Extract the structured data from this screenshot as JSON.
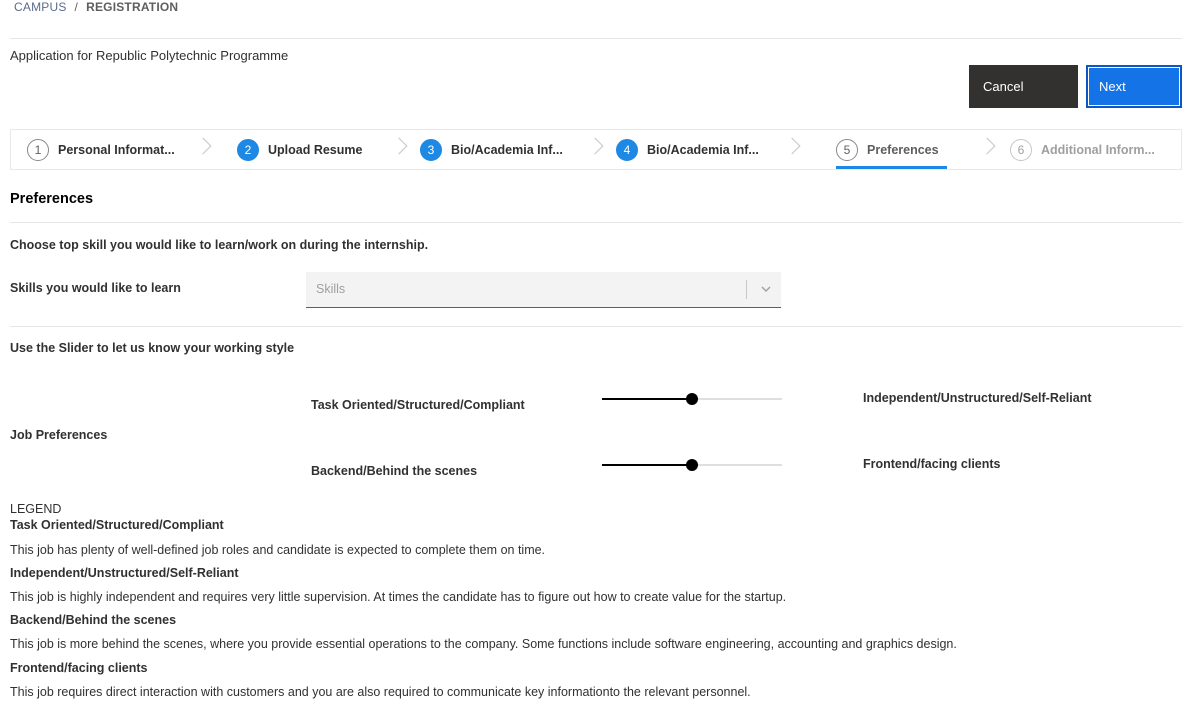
{
  "breadcrumb": {
    "root": "CAMPUS",
    "separator": "/",
    "current": "REGISTRATION"
  },
  "page_title": "Application for Republic Polytechnic Programme",
  "actions": {
    "cancel": "Cancel",
    "next": "Next"
  },
  "steps": [
    {
      "num": "1",
      "label": "Personal Informat...",
      "state": "completed"
    },
    {
      "num": "2",
      "label": "Upload Resume",
      "state": "completed"
    },
    {
      "num": "3",
      "label": "Bio/Academia Inf...",
      "state": "completed"
    },
    {
      "num": "4",
      "label": "Bio/Academia Inf...",
      "state": "completed"
    },
    {
      "num": "5",
      "label": "Preferences",
      "state": "current"
    },
    {
      "num": "6",
      "label": "Additional Inform...",
      "state": "pending"
    }
  ],
  "section_title": "Preferences",
  "skills": {
    "question": "Choose top skill you would like to learn/work on during the internship.",
    "label": "Skills you would like to learn",
    "placeholder": "Skills"
  },
  "working_style": {
    "prompt": "Use the Slider to let us know your working style",
    "group_label": "Job Preferences",
    "sliders": [
      {
        "left": "Task Oriented/Structured/Compliant",
        "right": "Independent/Unstructured/Self-Reliant",
        "value_fraction": 0.5
      },
      {
        "left": "Backend/Behind the scenes",
        "right": "Frontend/facing clients",
        "value_fraction": 0.5
      }
    ]
  },
  "legend": {
    "heading": "LEGEND",
    "items": [
      {
        "term": "Task Oriented/Structured/Compliant",
        "text": "This job has plenty of well-defined job roles and candidate is expected to complete them on time."
      },
      {
        "term": "Independent/Unstructured/Self-Reliant",
        "text": "This job is highly independent and requires very little supervision. At times the candidate has to figure out how to create value for the startup."
      },
      {
        "term": "Backend/Behind the scenes",
        "text": "This job is more behind the scenes, where you provide essential operations to the company. Some functions include software engineering, accounting and graphics design."
      },
      {
        "term": "Frontend/facing clients",
        "text": "This job requires direct interaction with customers and you are also required to communicate key informationto the relevant personnel."
      }
    ]
  },
  "colors": {
    "primary": "#1473e6",
    "step_active": "#1e88e5",
    "cancel_bg": "#323130"
  }
}
